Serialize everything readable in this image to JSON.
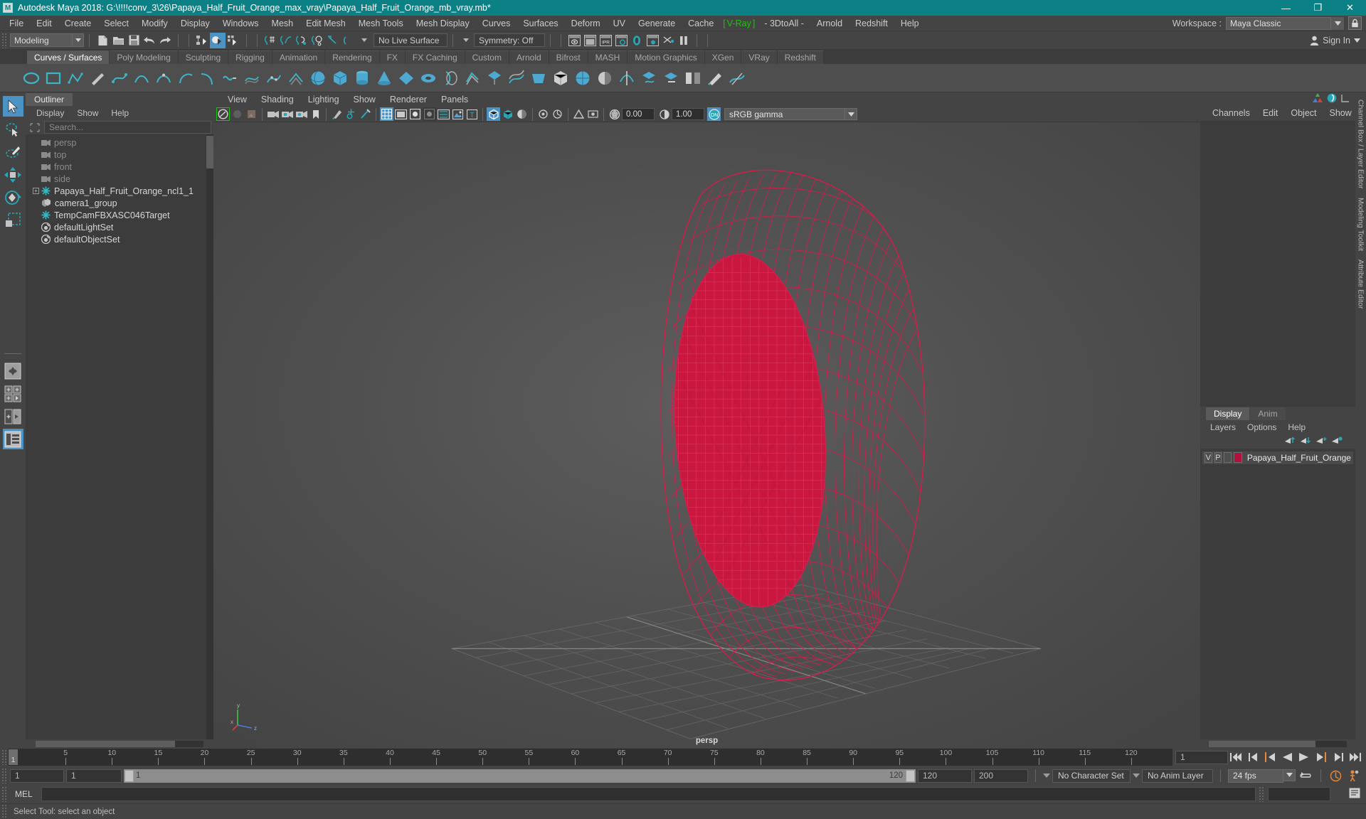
{
  "window": {
    "title": "Autodesk Maya 2018: G:\\!!!!conv_3\\26\\Papaya_Half_Fruit_Orange_max_vray\\Papaya_Half_Fruit_Orange_mb_vray.mb*",
    "logo": "M",
    "minimize": "—",
    "maximize": "❐",
    "close": "✕",
    "title_bg": "#0b8186"
  },
  "menubar": {
    "items": [
      "File",
      "Edit",
      "Create",
      "Select",
      "Modify",
      "Display",
      "Windows",
      "Mesh",
      "Edit Mesh",
      "Mesh Tools",
      "Mesh Display",
      "Curves",
      "Surfaces",
      "Deform",
      "UV",
      "Generate",
      "Cache"
    ],
    "vray": "V-Ray",
    "vray_color": "#16c60c",
    "after_vray": [
      "- 3DtoAll -",
      "Arnold",
      "Redshift",
      "Help"
    ],
    "workspace_label": "Workspace :",
    "workspace_value": "Maya Classic",
    "lock_icon": "lock-icon"
  },
  "statusline": {
    "mode": "Modeling",
    "live_surface": "No Live Surface",
    "symmetry": "Symmetry: Off",
    "signin": "Sign In"
  },
  "shelf": {
    "tabs": [
      {
        "label": "Curves / Surfaces",
        "active": true
      },
      {
        "label": "Poly Modeling",
        "active": false
      },
      {
        "label": "Sculpting",
        "active": false
      },
      {
        "label": "Rigging",
        "active": false
      },
      {
        "label": "Animation",
        "active": false
      },
      {
        "label": "Rendering",
        "active": false
      },
      {
        "label": "FX",
        "active": false
      },
      {
        "label": "FX Caching",
        "active": false
      },
      {
        "label": "Custom",
        "active": false
      },
      {
        "label": "Arnold",
        "active": false
      },
      {
        "label": "Bifrost",
        "active": false
      },
      {
        "label": "MASH",
        "active": false
      },
      {
        "label": "Motion Graphics",
        "active": false
      },
      {
        "label": "XGen",
        "active": false
      },
      {
        "label": "VRay",
        "active": false
      },
      {
        "label": "Redshift",
        "active": false
      }
    ]
  },
  "outliner": {
    "tab": "Outliner",
    "menu": [
      "Display",
      "Show",
      "Help"
    ],
    "search_placeholder": "Search...",
    "items": [
      {
        "label": "persp",
        "icon": "camera-icon",
        "dim": true,
        "expand": false
      },
      {
        "label": "top",
        "icon": "camera-icon",
        "dim": true,
        "expand": false
      },
      {
        "label": "front",
        "icon": "camera-icon",
        "dim": true,
        "expand": false
      },
      {
        "label": "side",
        "icon": "camera-icon",
        "dim": true,
        "expand": false
      },
      {
        "label": "Papaya_Half_Fruit_Orange_ncl1_1",
        "icon": "transform-icon",
        "dim": false,
        "expand": true
      },
      {
        "label": "camera1_group",
        "icon": "group-icon",
        "dim": false,
        "expand": false
      },
      {
        "label": "TempCamFBXASC046Target",
        "icon": "transform-icon",
        "dim": false,
        "expand": false
      },
      {
        "label": "defaultLightSet",
        "icon": "set-icon",
        "dim": false,
        "expand": false
      },
      {
        "label": "defaultObjectSet",
        "icon": "set-icon",
        "dim": false,
        "expand": false
      }
    ]
  },
  "viewport": {
    "menu": [
      "View",
      "Shading",
      "Lighting",
      "Show",
      "Renderer",
      "Panels"
    ],
    "exposure": "0.00",
    "gamma": "1.00",
    "color_space": "sRGB gamma",
    "camera_label": "persp",
    "model_color": "#d81b4a",
    "axis": {
      "x": "x",
      "y": "y",
      "z": "z"
    }
  },
  "channelbox": {
    "tabs": [
      "Channels",
      "Edit",
      "Object",
      "Show"
    ]
  },
  "layers": {
    "tabs": [
      {
        "label": "Display",
        "active": true
      },
      {
        "label": "Anim",
        "active": false
      }
    ],
    "menu": [
      "Layers",
      "Options",
      "Help"
    ],
    "rows": [
      {
        "v": "V",
        "p": "P",
        "color": "#b3103c",
        "name": "Papaya_Half_Fruit_Orange"
      }
    ]
  },
  "vertical_tabs": [
    "Channel Box / Layer Editor",
    "Modeling Toolkit",
    "Attribute Editor"
  ],
  "timeline": {
    "current_frame": "1",
    "start": "1",
    "end": "120",
    "ticks": [
      {
        "v": 5,
        "label": "5"
      },
      {
        "v": 10,
        "label": "10"
      },
      {
        "v": 15,
        "label": "15"
      },
      {
        "v": 20,
        "label": "20"
      },
      {
        "v": 25,
        "label": "25"
      },
      {
        "v": 30,
        "label": "30"
      },
      {
        "v": 35,
        "label": "35"
      },
      {
        "v": 40,
        "label": "40"
      },
      {
        "v": 45,
        "label": "45"
      },
      {
        "v": 50,
        "label": "50"
      },
      {
        "v": 55,
        "label": "55"
      },
      {
        "v": 60,
        "label": "60"
      },
      {
        "v": 65,
        "label": "65"
      },
      {
        "v": 70,
        "label": "70"
      },
      {
        "v": 75,
        "label": "75"
      },
      {
        "v": 80,
        "label": "80"
      },
      {
        "v": 85,
        "label": "85"
      },
      {
        "v": 90,
        "label": "90"
      },
      {
        "v": 95,
        "label": "95"
      },
      {
        "v": 100,
        "label": "100"
      },
      {
        "v": 105,
        "label": "105"
      },
      {
        "v": 110,
        "label": "110"
      },
      {
        "v": 115,
        "label": "115"
      },
      {
        "v": 120,
        "label": "120"
      }
    ],
    "frame_field": "1"
  },
  "range": {
    "anim_start": "1",
    "range_start": "1",
    "slider_start": "1",
    "slider_end": "120",
    "range_end": "120",
    "anim_end": "200",
    "character_set": "No Character Set",
    "anim_layer": "No Anim Layer",
    "fps": "24 fps"
  },
  "mel": {
    "label": "MEL",
    "command": ""
  },
  "status": {
    "message": "Select Tool: select an object"
  }
}
